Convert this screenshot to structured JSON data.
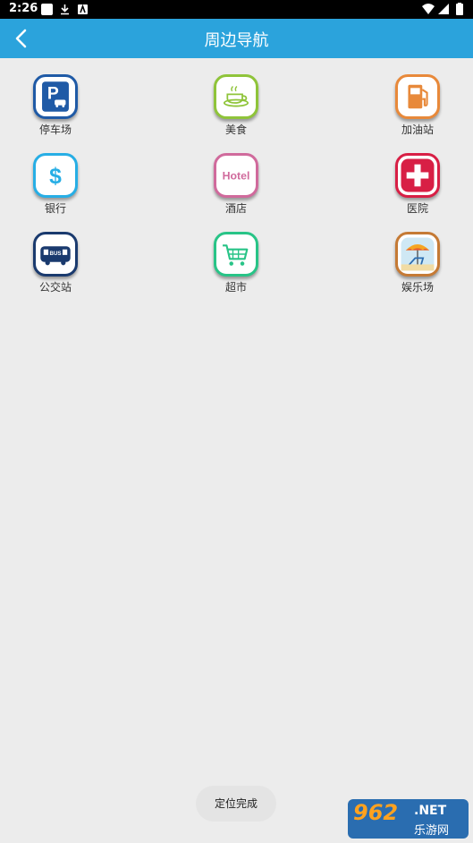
{
  "status": {
    "time": "2:26"
  },
  "header": {
    "title": "周边导航"
  },
  "grid": [
    {
      "label": "停车场",
      "icon": "parking-icon",
      "color": "#1f5aa6"
    },
    {
      "label": "美食",
      "icon": "coffee-cup-icon",
      "color": "#8fc43a"
    },
    {
      "label": "加油站",
      "icon": "gas-pump-icon",
      "color": "#e8893a"
    },
    {
      "label": "银行",
      "icon": "dollar-icon",
      "color": "#27aee5"
    },
    {
      "label": "酒店",
      "icon": "hotel-icon",
      "color": "#d06a9c",
      "text": "Hotel"
    },
    {
      "label": "医院",
      "icon": "medical-cross-icon",
      "color": "#d81f45"
    },
    {
      "label": "公交站",
      "icon": "bus-icon",
      "color": "#1a3a6e",
      "text": "BUS"
    },
    {
      "label": "超市",
      "icon": "shopping-cart-icon",
      "color": "#28c487"
    },
    {
      "label": "娱乐场",
      "icon": "beach-umbrella-icon",
      "color": "#c57a35"
    }
  ],
  "toast": {
    "message": "定位完成"
  },
  "watermark": {
    "number": "962",
    "domain": ".NET",
    "site": "乐游网"
  }
}
